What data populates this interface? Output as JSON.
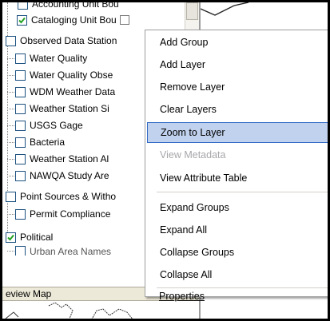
{
  "tree": {
    "rows": [
      {
        "label": "Accounting Unit Bou",
        "checked": false
      },
      {
        "label": "Cataloging Unit Bou",
        "checked": true
      },
      {
        "label": "Observed Data Station",
        "checked": false
      },
      {
        "label": "Water Quality",
        "checked": false
      },
      {
        "label": "Water Quality Obse",
        "checked": false
      },
      {
        "label": "WDM Weather Data",
        "checked": false
      },
      {
        "label": "Weather Station Si",
        "checked": false
      },
      {
        "label": "USGS Gage",
        "checked": false
      },
      {
        "label": "Bacteria",
        "checked": false
      },
      {
        "label": "Weather Station Al",
        "checked": false
      },
      {
        "label": "NAWQA Study Are",
        "checked": false
      },
      {
        "label": "Point Sources & Witho",
        "checked": false
      },
      {
        "label": "Permit Compliance",
        "checked": false
      },
      {
        "label": "Political",
        "checked": true
      },
      {
        "label": "Urban Area Names",
        "checked": false
      }
    ]
  },
  "overview": {
    "title": "eview Map"
  },
  "context_menu": {
    "items": [
      {
        "label": "Add Group",
        "state": "normal"
      },
      {
        "label": "Add Layer",
        "state": "normal"
      },
      {
        "label": "Remove Layer",
        "state": "normal"
      },
      {
        "label": "Clear Layers",
        "state": "normal"
      },
      {
        "label": "Zoom to Layer",
        "state": "hover"
      },
      {
        "label": "View Metadata",
        "state": "disabled"
      },
      {
        "label": "View Attribute Table",
        "state": "normal"
      },
      {
        "label": "Expand Groups",
        "state": "normal"
      },
      {
        "label": "Expand All",
        "state": "normal"
      },
      {
        "label": "Collapse Groups",
        "state": "normal"
      },
      {
        "label": "Collapse All",
        "state": "normal"
      },
      {
        "label": "Properties",
        "state": "normal"
      }
    ]
  },
  "colors": {
    "hover_fill": "#c1d2ee",
    "hover_border": "#316ac5",
    "checkbox_border": "#1c5180",
    "check_mark": "#21a121",
    "disabled_text": "#a7a6aa"
  }
}
